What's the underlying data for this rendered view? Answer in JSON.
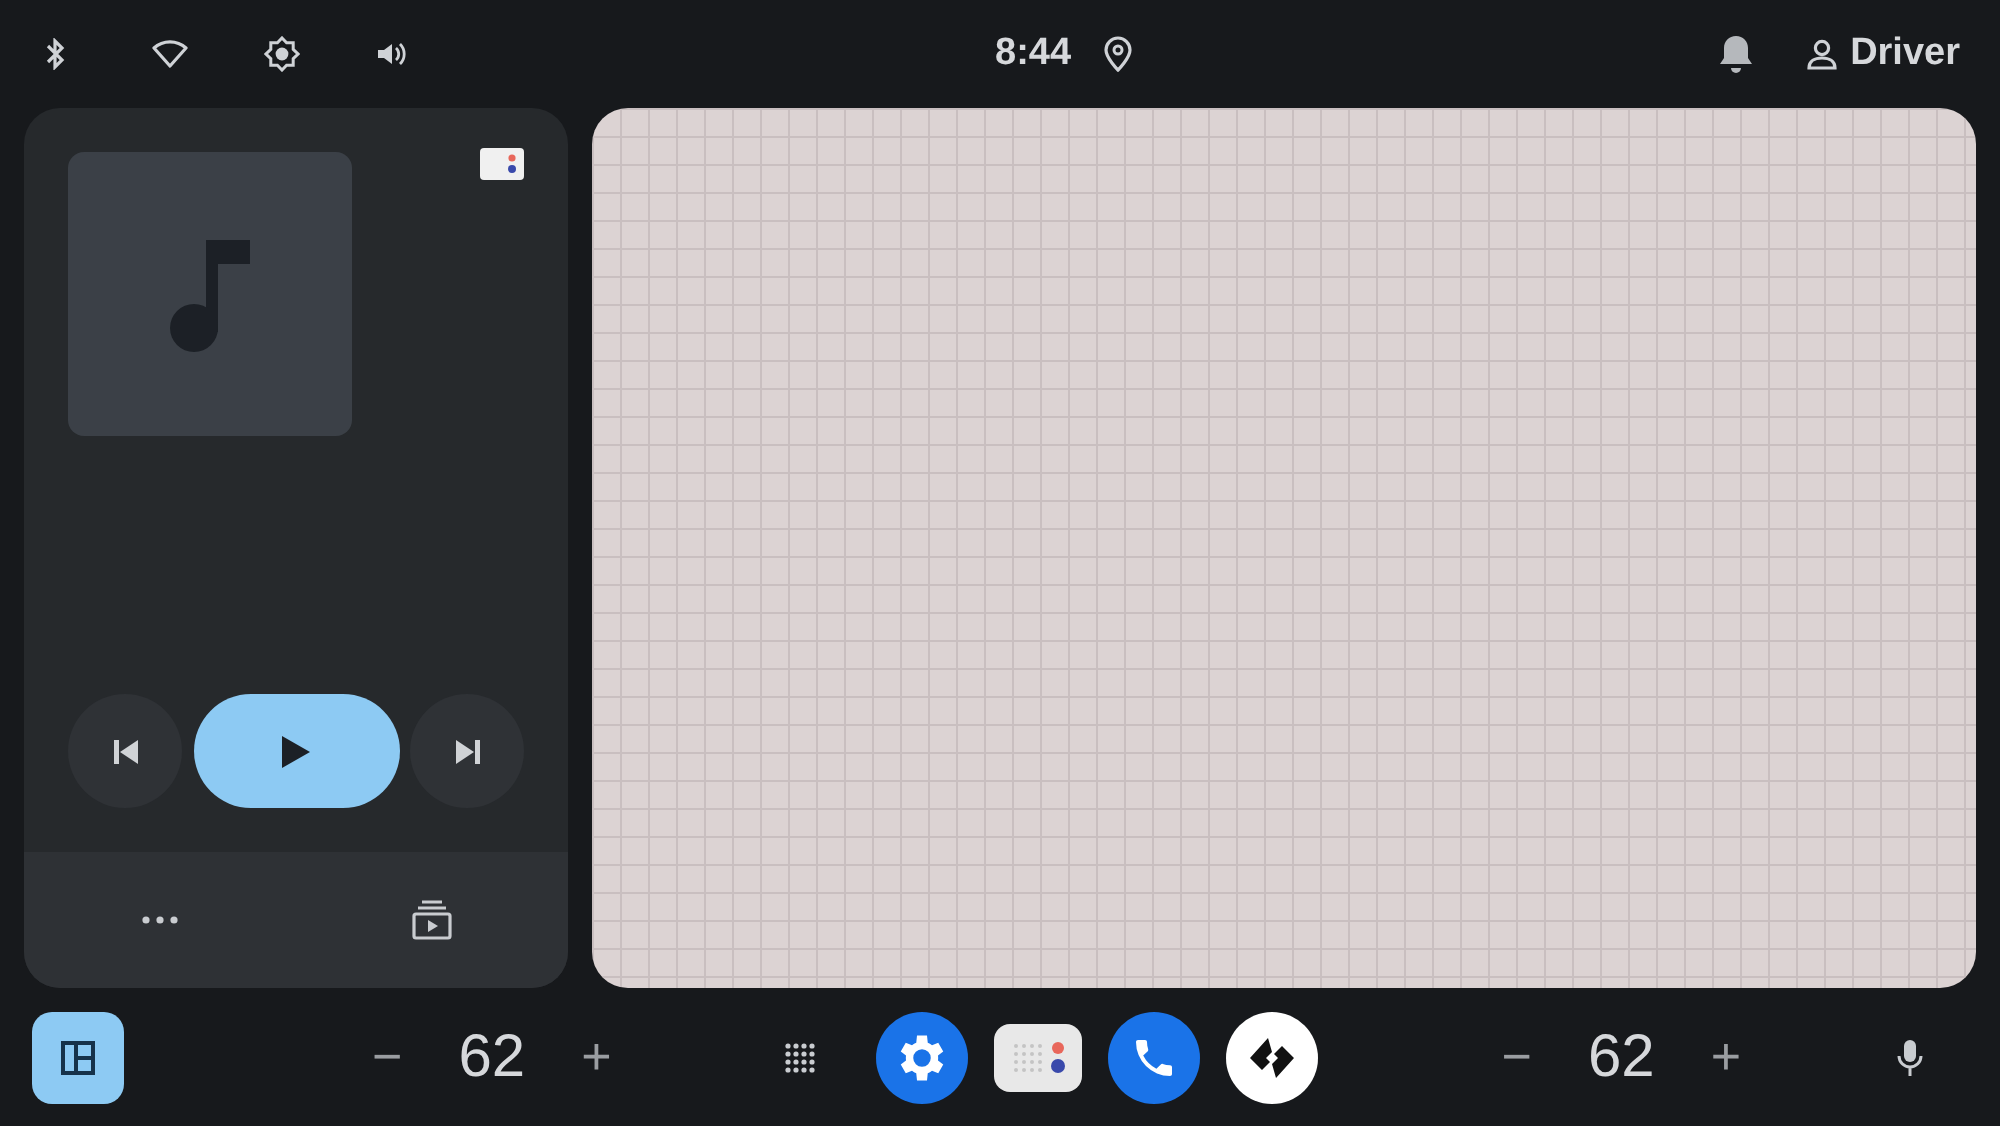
{
  "status_bar": {
    "time": "8:44",
    "user": "Driver"
  },
  "climate": [
    {
      "minus": "−",
      "value": "62",
      "plus": "+"
    },
    {
      "minus": "−",
      "value": "62",
      "plus": "+"
    }
  ],
  "dock": [
    {
      "kind": "settings"
    },
    {
      "kind": "assistant"
    },
    {
      "kind": "phone"
    },
    {
      "kind": "app"
    }
  ]
}
